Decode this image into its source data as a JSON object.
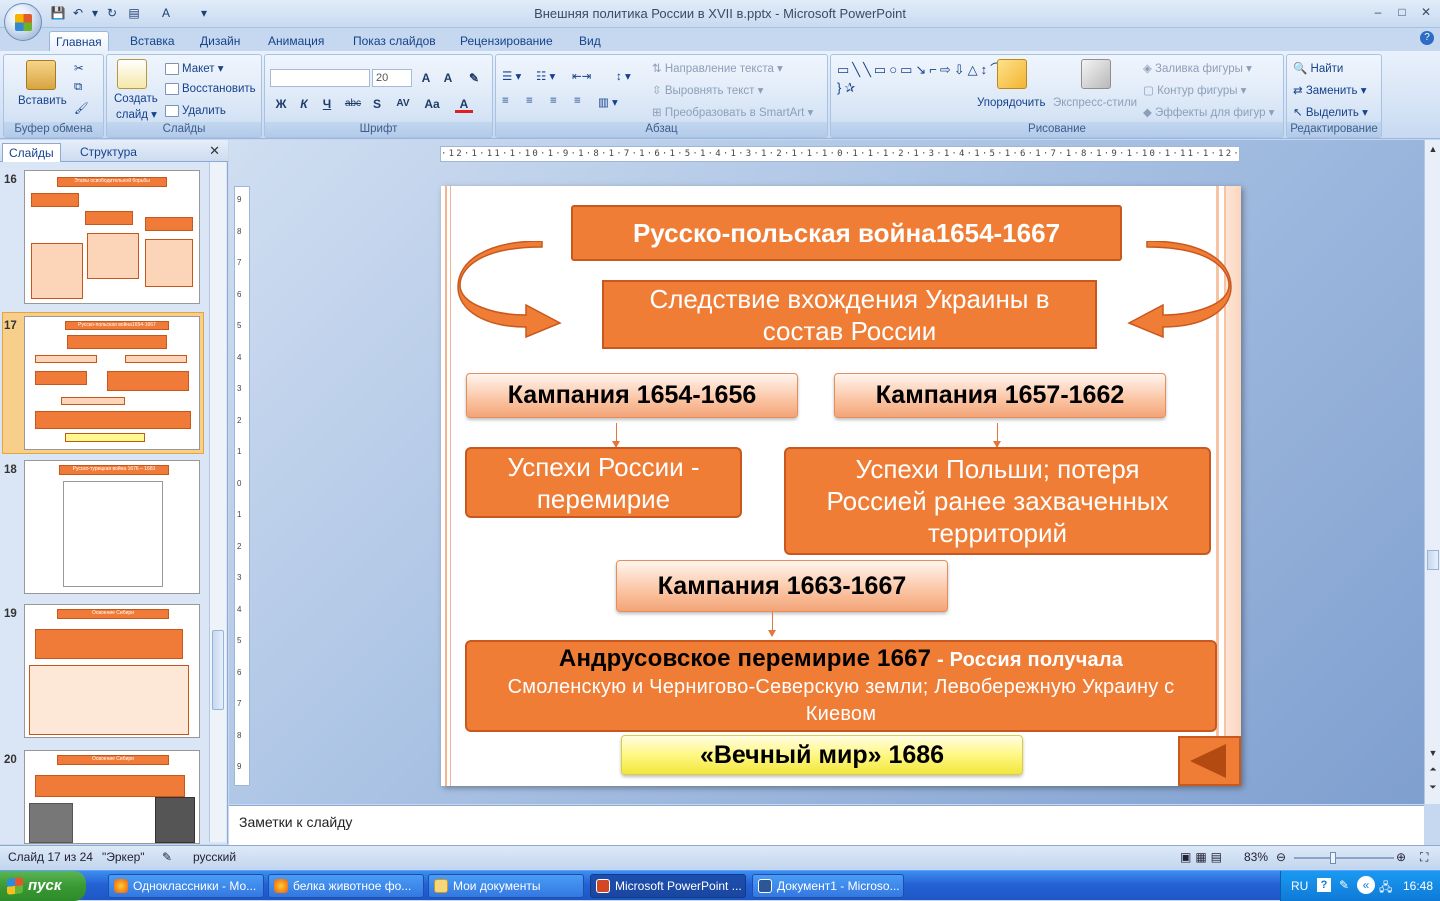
{
  "window": {
    "title": "Внешняя политика России в XVII в.pptx - Microsoft PowerPoint",
    "controls": [
      "–",
      "□",
      "✕"
    ]
  },
  "ribbon_tabs": [
    "Главная",
    "Вставка",
    "Дизайн",
    "Анимация",
    "Показ слайдов",
    "Рецензирование",
    "Вид"
  ],
  "ribbon": {
    "clipboard": {
      "paste": "Вставить",
      "label": "Буфер обмена"
    },
    "slides": {
      "create": "Создать",
      "create2": "слайд ▾",
      "layout": "Макет ▾",
      "reset": "Восстановить",
      "delete": "Удалить",
      "label": "Слайды"
    },
    "font": {
      "size": "20",
      "label": "Шрифт",
      "buttons": [
        "Ж",
        "К",
        "Ч",
        "abc",
        "S",
        "AV",
        "Aa",
        "A"
      ]
    },
    "paragraph": {
      "text_dir": "Направление текста ▾",
      "align_text": "Выровнять текст ▾",
      "smartart": "Преобразовать в SmartArt ▾",
      "label": "Абзац"
    },
    "drawing": {
      "arrange": "Упорядочить",
      "quick_styles": "Экспресс-стили",
      "fill": "Заливка фигуры ▾",
      "outline": "Контур фигуры ▾",
      "effects": "Эффекты для фигур ▾",
      "label": "Рисование"
    },
    "editing": {
      "find": "Найти",
      "replace": "Заменить ▾",
      "select": "Выделить ▾",
      "label": "Редактирование"
    }
  },
  "left_pane": {
    "tabs": [
      "Слайды",
      "Структура"
    ],
    "close": "✕",
    "thumbs": [
      {
        "num": "16",
        "title": "Этапы освободительной борьбы"
      },
      {
        "num": "17",
        "title": "Русско-польская война1654-1667",
        "selected": true
      },
      {
        "num": "18",
        "title": "Русско-турецкая война 1676 – 1681"
      },
      {
        "num": "19",
        "title": "Освоение Сибири"
      },
      {
        "num": "20",
        "title": "Освоение Сибири"
      }
    ]
  },
  "ruler_h": "·12·1·11·1·10·1·9·1·8·1·7·1·6·1·5·1·4·1·3·1·2·1·1·1·0·1·1·1·2·1·3·1·4·1·5·1·6·1·7·1·8·1·9·1·10·1·11·1·12·",
  "ruler_v": [
    "9",
    "8",
    "7",
    "6",
    "5",
    "4",
    "3",
    "2",
    "1",
    "0",
    "1",
    "2",
    "3",
    "4",
    "5",
    "6",
    "7",
    "8",
    "9"
  ],
  "slide": {
    "title": "Русско-польская война1654-1667",
    "cause": "Следствие вхождения Украины в состав России",
    "campaign1": "Кампания 1654-1656",
    "campaign2": "Кампания 1657-1662",
    "result1": "Успехи России - перемирие",
    "result2": "Успехи Польши; потеря Россией ранее захваченных территорий",
    "campaign3": "Кампания 1663-1667",
    "andrusovo_bold": "Андрусовское перемирие 1667",
    "andrusovo_dash": " - ",
    "andrusovo_bold2": "Россия получала",
    "andrusovo_rest": "Смоленскую и Черниговo-Северскую земли; Левобережную Украину с Киевом",
    "eternal_peace": "«Вечный мир» 1686"
  },
  "notes_placeholder": "Заметки к слайду",
  "status": {
    "slide": "Слайд 17 из 24",
    "theme": "\"Эркер\"",
    "lang": "русский",
    "zoom": "83%"
  },
  "taskbar": {
    "start": "пуск",
    "items": [
      "Одноклассники - Мо...",
      "белка животное фо...",
      "Мои документы",
      "Microsoft PowerPoint ...",
      "Документ1 - Microso..."
    ],
    "lang": "RU",
    "time": "16:48"
  },
  "colors": {
    "accent": "#f07d36",
    "border": "#c9581f",
    "peach": "#fbc8a8",
    "yellow": "#fff784"
  }
}
